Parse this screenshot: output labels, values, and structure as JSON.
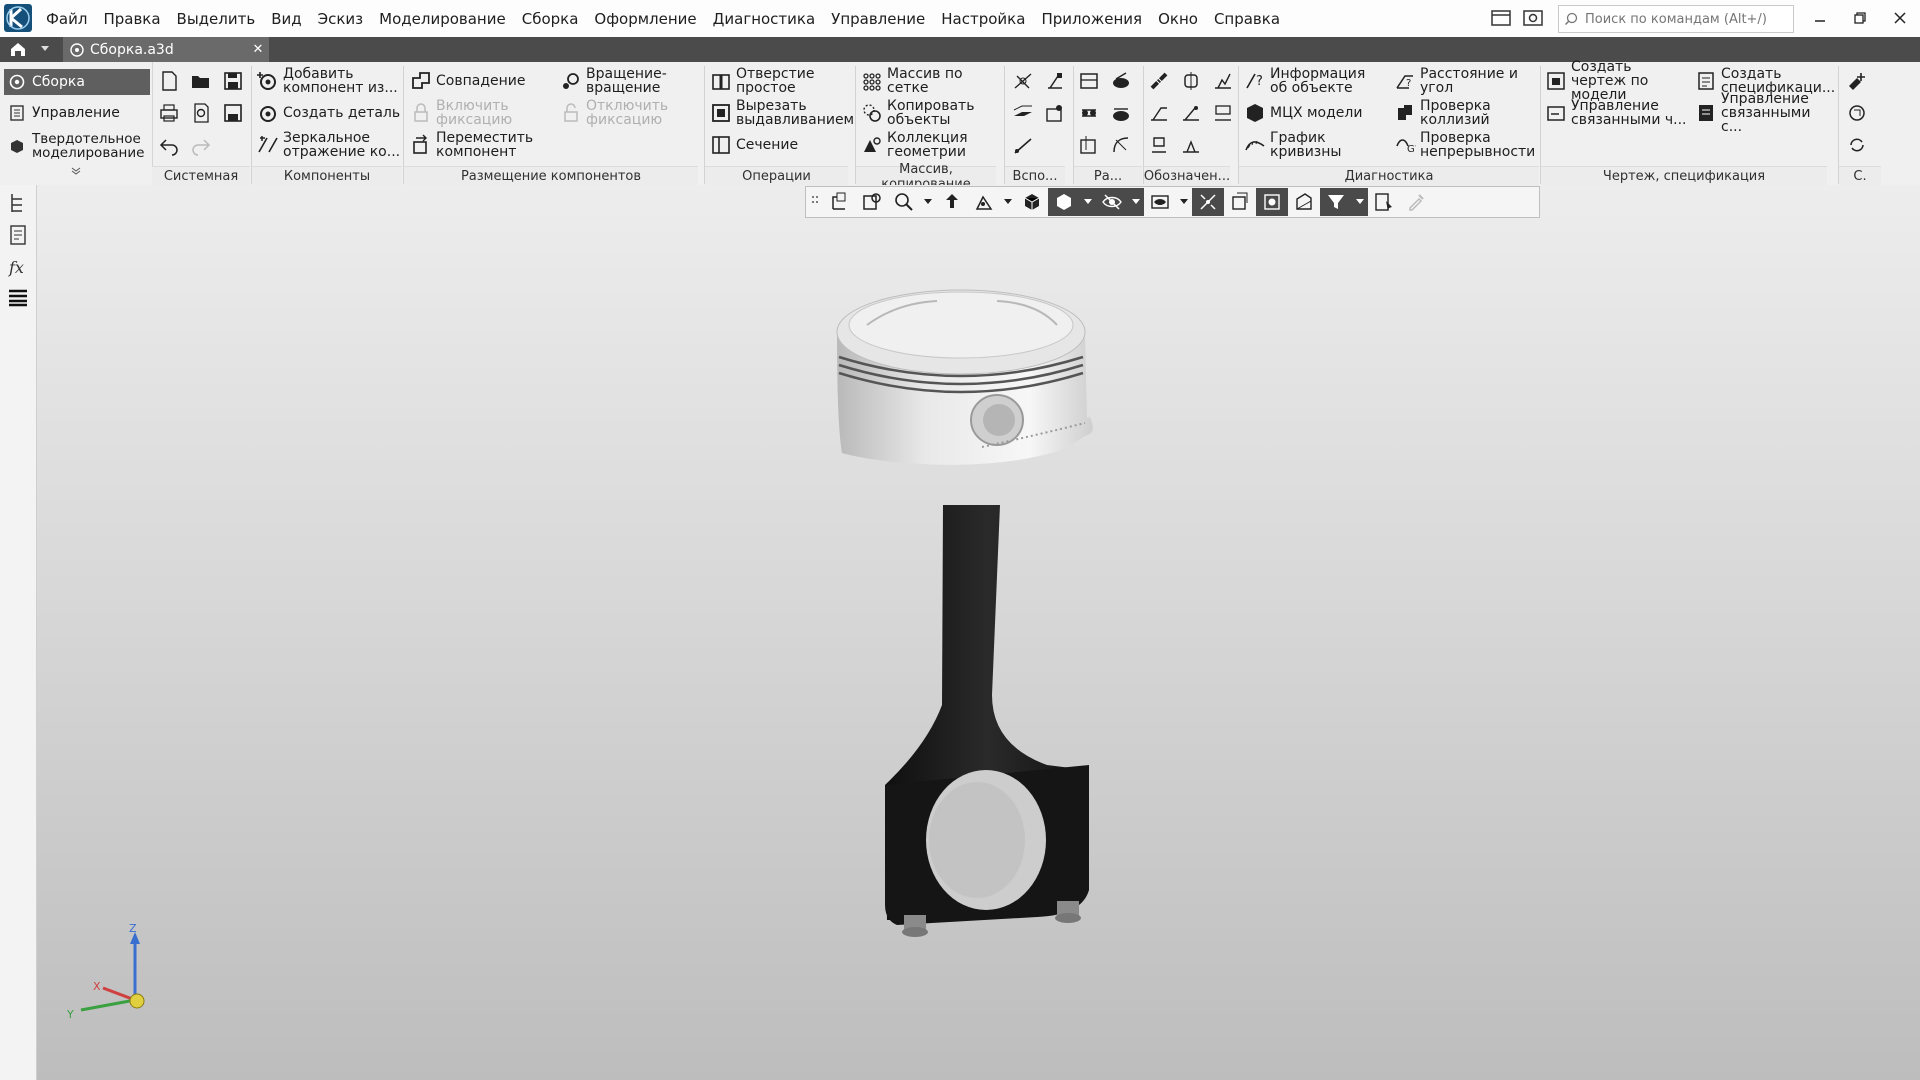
{
  "menu": [
    "Файл",
    "Правка",
    "Выделить",
    "Вид",
    "Эскиз",
    "Моделирование",
    "Сборка",
    "Оформление",
    "Диагностика",
    "Управление",
    "Настройка",
    "Приложения",
    "Окно",
    "Справка"
  ],
  "search": {
    "placeholder": "Поиск по командам (Alt+/)"
  },
  "document_tab": {
    "label": "Сборка.a3d"
  },
  "modes": [
    {
      "label": "Сборка",
      "active": true
    },
    {
      "label": "Управление",
      "active": false
    },
    {
      "label": "Твердотельное моделирование",
      "active": false
    }
  ],
  "groups": {
    "sistemnaya": "Системная",
    "komponenty": "Компоненты",
    "razmeshchenie": "Размещение компонентов",
    "operacii": "Операции",
    "massiv": "Массив, копирование",
    "vspo": "Вспо...",
    "ra": "Ра...",
    "oboznach": "Обозначен...",
    "diagnostika": "Диагностика",
    "chertezh": "Чертеж, спецификация",
    "s": "С."
  },
  "buttons": {
    "add_component": "Добавить компонент из...",
    "create_part": "Создать деталь",
    "mirror_component": "Зеркальное отражение ко...",
    "coincidence": "Совпадение",
    "enable_fix": "Включить фиксацию",
    "move_component": "Переместить компонент",
    "rotation": "Вращение-вращение",
    "disable_fix": "Отключить фиксацию",
    "simple_hole": "Отверстие простое",
    "extrude_cut": "Вырезать выдавливанием",
    "section": "Сечение",
    "grid_array": "Массив по сетке",
    "copy_objects": "Копировать объекты",
    "geometry_collection": "Коллекция геометрии",
    "object_info": "Информация об объекте",
    "mass_props": "МЦХ модели",
    "curvature_graph": "График кривизны",
    "distance_angle": "Расстояние и угол",
    "collision_check": "Проверка коллизий",
    "continuity_check": "Проверка непрерывности",
    "create_drawing": "Создать чертеж по модели",
    "manage_linked_drawings": "Управление связанными ч...",
    "create_spec": "Создать спецификаци...",
    "manage_linked_specs": "Управление связанными с..."
  },
  "axes": {
    "x": "X",
    "y": "Y",
    "z": "Z"
  },
  "colors": {
    "accent": "#5f5f5f",
    "tabbar": "#4b4b4b",
    "ribbon": "#f0f0f0",
    "viewport_top": "#ededed",
    "viewport_bottom": "#bdbdbd"
  }
}
